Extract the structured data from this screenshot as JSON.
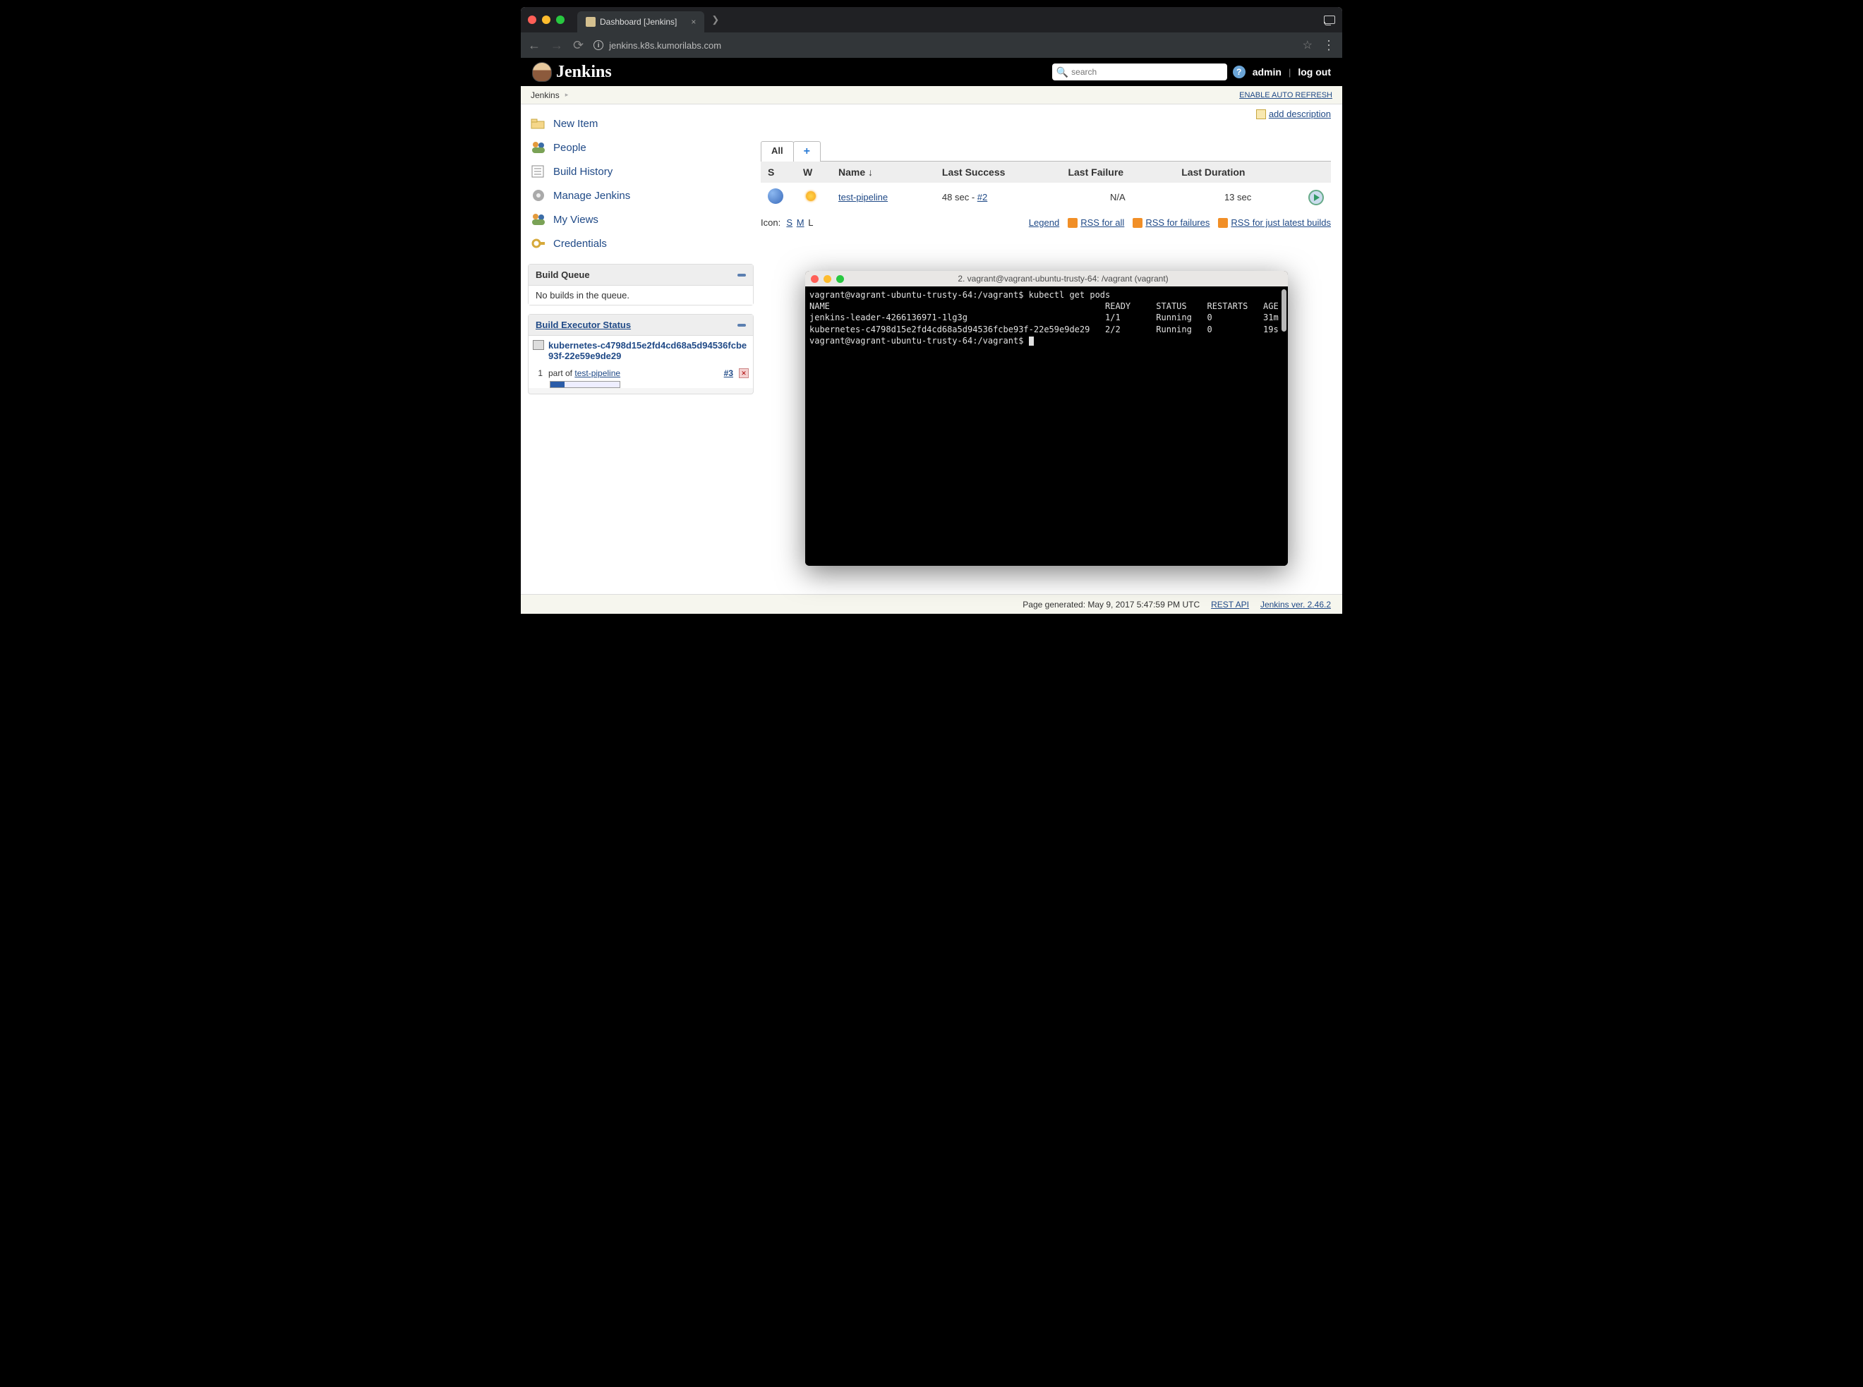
{
  "browser": {
    "tab_title": "Dashboard [Jenkins]",
    "url": "jenkins.k8s.kumorilabs.com"
  },
  "header": {
    "brand": "Jenkins",
    "search_placeholder": "search",
    "user": "admin",
    "logout": "log out"
  },
  "breadcrumb": {
    "root": "Jenkins",
    "auto_refresh": "ENABLE AUTO REFRESH"
  },
  "side_tasks": [
    "New Item",
    "People",
    "Build History",
    "Manage Jenkins",
    "My Views",
    "Credentials"
  ],
  "build_queue": {
    "title": "Build Queue",
    "empty": "No builds in the queue."
  },
  "executor": {
    "title": "Build Executor Status",
    "node_name": "kubernetes-c4798d15e2fd4cd68a5d94536fcbe93f-22e59e9de29",
    "row1_num": "1",
    "row1_text": "part of ",
    "row1_job": "test-pipeline",
    "row1_build": "#3"
  },
  "main": {
    "add_desc": "add description",
    "tab_all": "All",
    "columns": {
      "s": "S",
      "w": "W",
      "name": "Name  ↓",
      "last_success": "Last Success",
      "last_failure": "Last Failure",
      "last_duration": "Last Duration"
    },
    "jobs": [
      {
        "name": "test-pipeline",
        "last_success_time": "48 sec - ",
        "last_success_build": "#2",
        "last_failure": "N/A",
        "last_duration": "13 sec"
      }
    ],
    "icon_label": "Icon:",
    "icon_s": "S",
    "icon_m": "M",
    "icon_l": "L",
    "legend": "Legend",
    "rss_all": "RSS for all",
    "rss_failures": "RSS for failures",
    "rss_latest": "RSS for just latest builds"
  },
  "footer": {
    "generated": "Page generated: May 9, 2017 5:47:59 PM UTC",
    "rest": "REST API",
    "version": "Jenkins ver. 2.46.2"
  },
  "terminal": {
    "title": "2. vagrant@vagrant-ubuntu-trusty-64: /vagrant (vagrant)",
    "prompt1": "vagrant@vagrant-ubuntu-trusty-64:/vagrant$ kubectl get pods",
    "header_row": "NAME                                                      READY     STATUS    RESTARTS   AGE",
    "row1": "jenkins-leader-4266136971-1lg3g                           1/1       Running   0          31m",
    "row2": "kubernetes-c4798d15e2fd4cd68a5d94536fcbe93f-22e59e9de29   2/2       Running   0          19s",
    "prompt2": "vagrant@vagrant-ubuntu-trusty-64:/vagrant$ "
  }
}
